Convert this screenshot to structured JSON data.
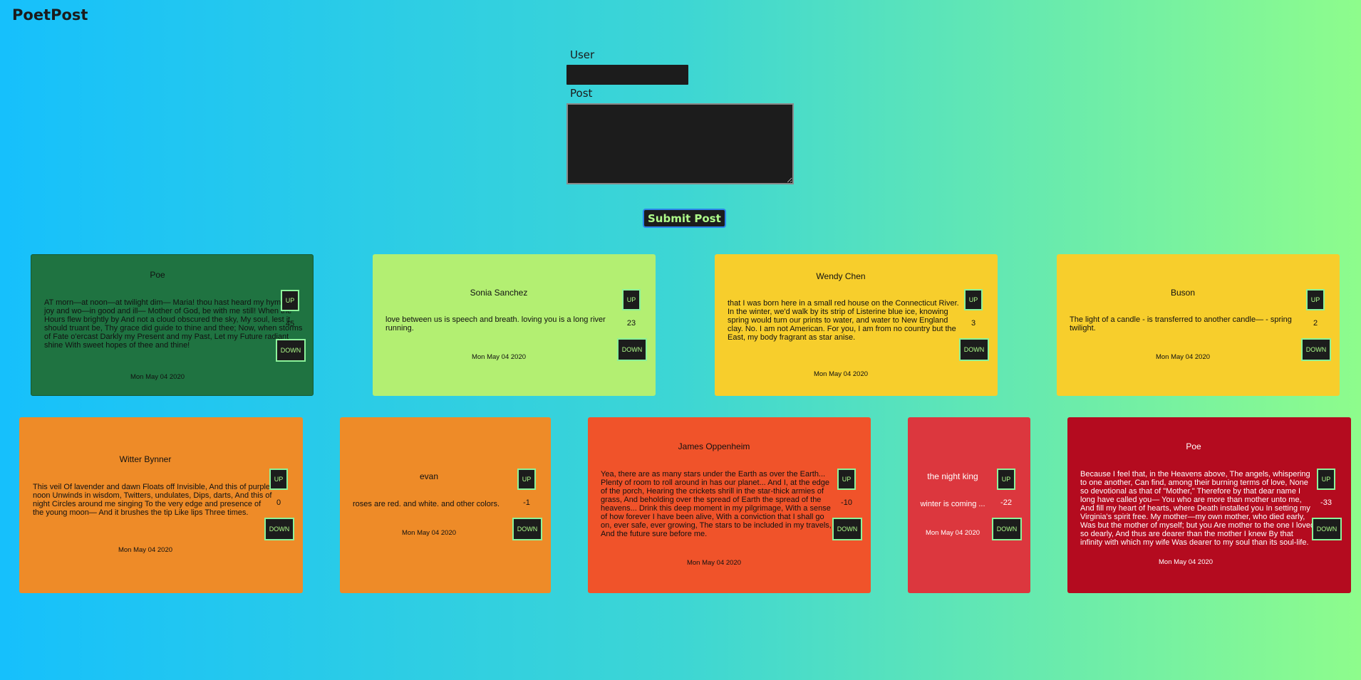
{
  "app": {
    "title": "PoetPost"
  },
  "form": {
    "user_label": "User",
    "post_label": "Post",
    "user_value": "",
    "post_value": "",
    "submit_label": "Submit Post"
  },
  "vote_labels": {
    "up": "UP",
    "down": "DOWN"
  },
  "posts": [
    {
      "author": "Poe",
      "content": "AT morn—at noon—at twilight dim— Maria! thou hast heard my hymn! In joy and wo—in good and ill— Mother of God, be with me still! When the Hours flew brightly by And not a cloud obscured the sky, My soul, lest it should truant be, Thy grace did guide to thine and thee; Now, when storms of Fate o'ercast Darkly my Present and my Past, Let my Future radiant shine With sweet hopes of thee and thine!",
      "score": "45",
      "date": "Mon May 04 2020",
      "color": "#1f7341"
    },
    {
      "author": "Sonia Sanchez",
      "content": "love between us is speech and breath. loving you is a long river running.",
      "score": "23",
      "date": "Mon May 04 2020",
      "color": "#b3ef72"
    },
    {
      "author": "Wendy Chen",
      "content": "that I was born here in a small red house on the Connecticut River. In the winter, we'd walk by its strip of Listerine blue ice, knowing spring would turn our prints to water, and water to New England clay. No. I am not American. For you, I am from no country but the East, my body fragrant as star anise.",
      "score": "3",
      "date": "Mon May 04 2020",
      "color": "#f7ce2c"
    },
    {
      "author": "Buson",
      "content": "The light of a candle - is transferred to another candle— - spring twilight.",
      "score": "2",
      "date": "Mon May 04 2020",
      "color": "#f7ce2c"
    },
    {
      "author": "Witter Bynner",
      "content": "This veil Of lavender and dawn Floats off Invisible, And this of purple noon Unwinds in wisdom, Twitters, undulates, Dips, darts, And this of night Circles around me singing To the very edge and presence of the young moon— And it brushes the tip Like lips Three times.",
      "score": "0",
      "date": "Mon May 04 2020",
      "color": "#ee8b28"
    },
    {
      "author": "evan",
      "content": "roses are red. and white. and other colors.",
      "score": "-1",
      "date": "Mon May 04 2020",
      "color": "#ee8b28"
    },
    {
      "author": "James Oppenheim",
      "content": "Yea, there are as many stars under the Earth as over the Earth... Plenty of room to roll around in has our planet... And I, at the edge of the porch, Hearing the crickets shrill in the star-thick armies of grass, And beholding over the spread of Earth the spread of the heavens... Drink this deep moment in my pilgrimage, With a sense of how forever I have been alive, With a conviction that I shall go on, ever safe, ever growing, The stars to be included in my travels, And the future sure before me.",
      "score": "-10",
      "date": "Mon May 04 2020",
      "color": "#f0532a"
    },
    {
      "author": "the night king",
      "content": "winter is coming ...",
      "score": "-22",
      "date": "Mon May 04 2020",
      "color": "#dc373e"
    },
    {
      "author": "Poe",
      "content": "Because I feel that, in the Heavens above, The angels, whispering to one another, Can find, among their burning terms of love, None so devotional as that of \"Mother,\" Therefore by that dear name I long have called you— You who are more than mother unto me, And fill my heart of hearts, where Death installed you In setting my Virginia's spirit free. My mother—my own mother, who died early, Was but the mother of myself; but you Are mother to the one I loved so dearly, And thus are dearer than the mother I knew By that infinity with which my wife Was dearer to my soul than its soul-life.",
      "score": "-33",
      "date": "Mon May 04 2020",
      "color": "#b40b1f"
    }
  ]
}
